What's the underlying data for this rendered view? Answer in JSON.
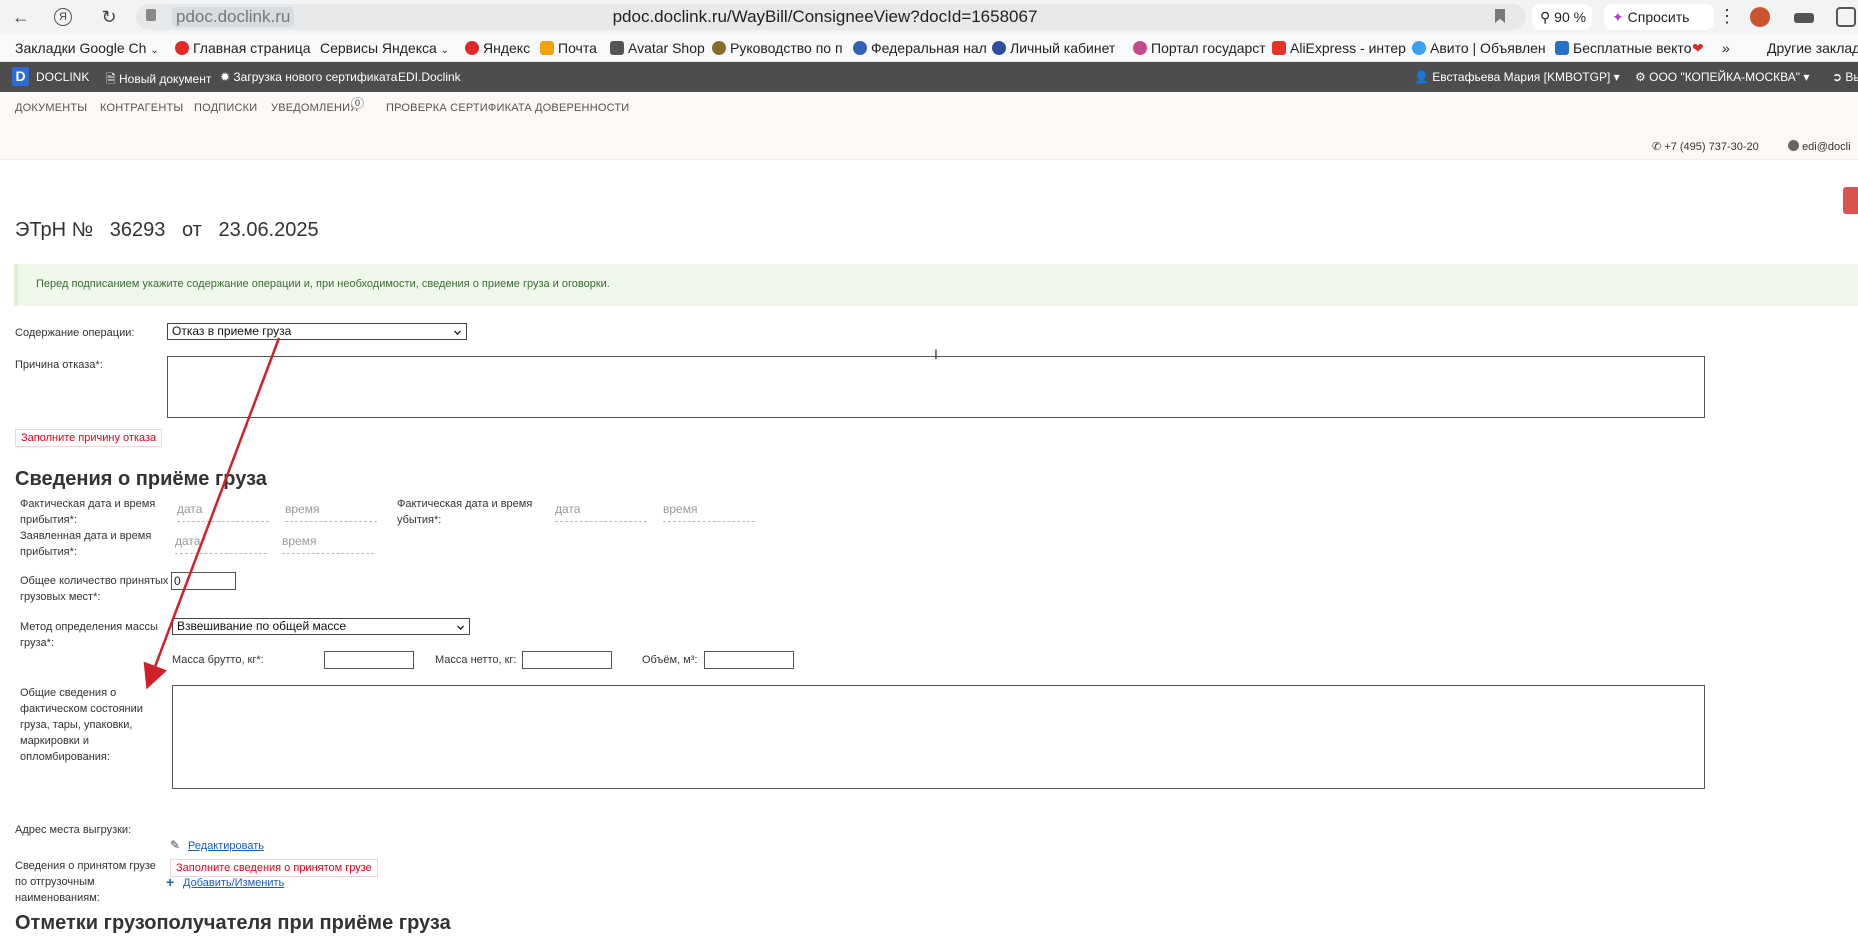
{
  "browser": {
    "domain": "pdoc.doclink.ru",
    "url": "pdoc.doclink.ru/WayBill/ConsigneeView?docId=1658067",
    "zoom": "90 %",
    "ask": "Спросить"
  },
  "bookmarks": [
    "Закладки Google Ch",
    "Главная страница",
    "Сервисы Яндекса",
    "Яндекс",
    "Почта",
    "Avatar Shop",
    "Руководство по п",
    "Федеральная нал",
    "Личный кабинет",
    "Портал государст",
    "AliExpress - интер",
    "Авито | Объявлен",
    "Бесплатные векто",
    "»",
    "Другие заклад"
  ],
  "appbar": {
    "logo": "DOCLINK",
    "new_doc": "Новый документ",
    "upload_cert": "Загрузка нового сертификата",
    "edi": "EDI.Doclink",
    "user": "Евстафьева Мария [KMBOTGP]",
    "org": "ООО \"КОПЕЙКА-МОСКВА\"",
    "exit": "Вы"
  },
  "menu": {
    "documents": "ДОКУМЕНТЫ",
    "counterparties": "КОНТРАГЕНТЫ",
    "signatures": "ПОДПИСКИ",
    "notifications": "УВЕДОМЛЕНИЯ",
    "notifications_count": "0",
    "cert_check": "ПРОВЕРКА СЕРТИФИКАТА",
    "powers": "ДОВЕРЕННОСТИ"
  },
  "contacts": {
    "phone": "+7 (495) 737-30-20",
    "email": "edi@docli"
  },
  "doc": {
    "title": "ЭТрН №   36293   от   23.06.2025",
    "alert": "Перед подписанием укажите содержание операции и, при необходимости, сведения о приеме груза и оговорки."
  },
  "form": {
    "operation_label": "Содержание операции:",
    "operation_value": "Отказ в приеме груза",
    "reason_label": "Причина отказа*:",
    "reason_error": "Заполните причину отказа",
    "section_receipt": "Сведения о приёме груза",
    "actual_arrival_label": "Фактическая дата и время прибытия*:",
    "actual_departure_label": "Фактическая дата и время убытия*:",
    "declared_arrival_label": "Заявленная дата и время прибытия*:",
    "date_placeholder": "дата",
    "time_placeholder": "время",
    "total_places_label": "Общее количество принятых грузовых мест*:",
    "total_places_value": "0",
    "mass_method_label": "Метод определения массы груза*:",
    "mass_method_value": "Взвешивание по общей массе",
    "gross_label": "Масса брутто, кг*:",
    "net_label": "Масса нетто, кг:",
    "volume_label": "Объём, м³:",
    "state_label": "Общие сведения о фактическом состоянии груза, тары, упаковки, маркировки и опломбирования:",
    "unload_address_label": "Адрес места выгрузки:",
    "edit_link": "Редактировать",
    "accepted_goods_label": "Сведения о принятом грузе по отгрузочным наименованиям:",
    "accepted_goods_error": "Заполните сведения о принятом грузе",
    "add_change_link": "Добавить/Изменить",
    "section_marks": "Отметки грузополучателя при приёме груза"
  },
  "colors": {
    "appbar": "#4d4d4d",
    "alert_bg": "#eff6ea",
    "error": "#e4001a",
    "link": "#1a5fb4",
    "annotation_arrow": "#d0202a"
  }
}
